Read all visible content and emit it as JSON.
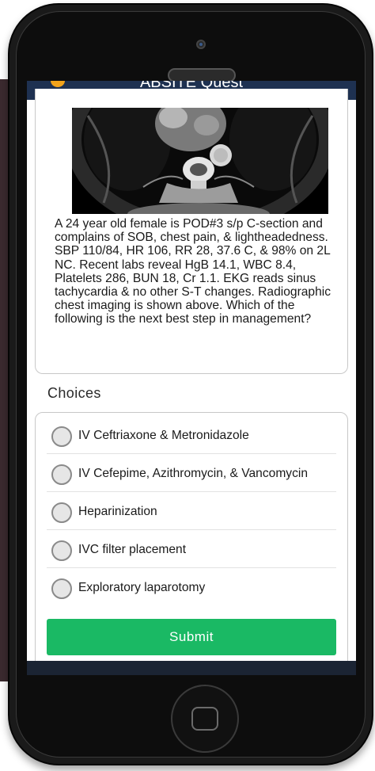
{
  "app": {
    "title": "ABSITE Quest"
  },
  "question": {
    "image_alt": "CT chest axial image",
    "text": "A 24 year old female is POD#3 s/p C-section and complains of SOB, chest pain, & lightheadedness. SBP 110/84, HR 106, RR 28, 37.6 C, & 98% on 2L NC. Recent labs reveal HgB 14.1, WBC 8.4, Platelets 286, BUN 18, Cr 1.1. EKG reads sinus tachycardia & no other S-T changes. Radiographic chest imaging is shown above. Which of the following is the next best step in management?"
  },
  "choices": {
    "heading": "Choices",
    "options": [
      {
        "label": "IV Ceftriaxone & Metronidazole"
      },
      {
        "label": "IV Cefepime, Azithromycin, & Vancomycin"
      },
      {
        "label": "Heparinization"
      },
      {
        "label": "IVC filter placement"
      },
      {
        "label": "Exploratory laparotomy"
      }
    ],
    "submit_label": "Submit"
  },
  "colors": {
    "header_bg": "#1e3151",
    "submit_bg": "#1ab964",
    "phone_body": "#1a1a1a"
  }
}
